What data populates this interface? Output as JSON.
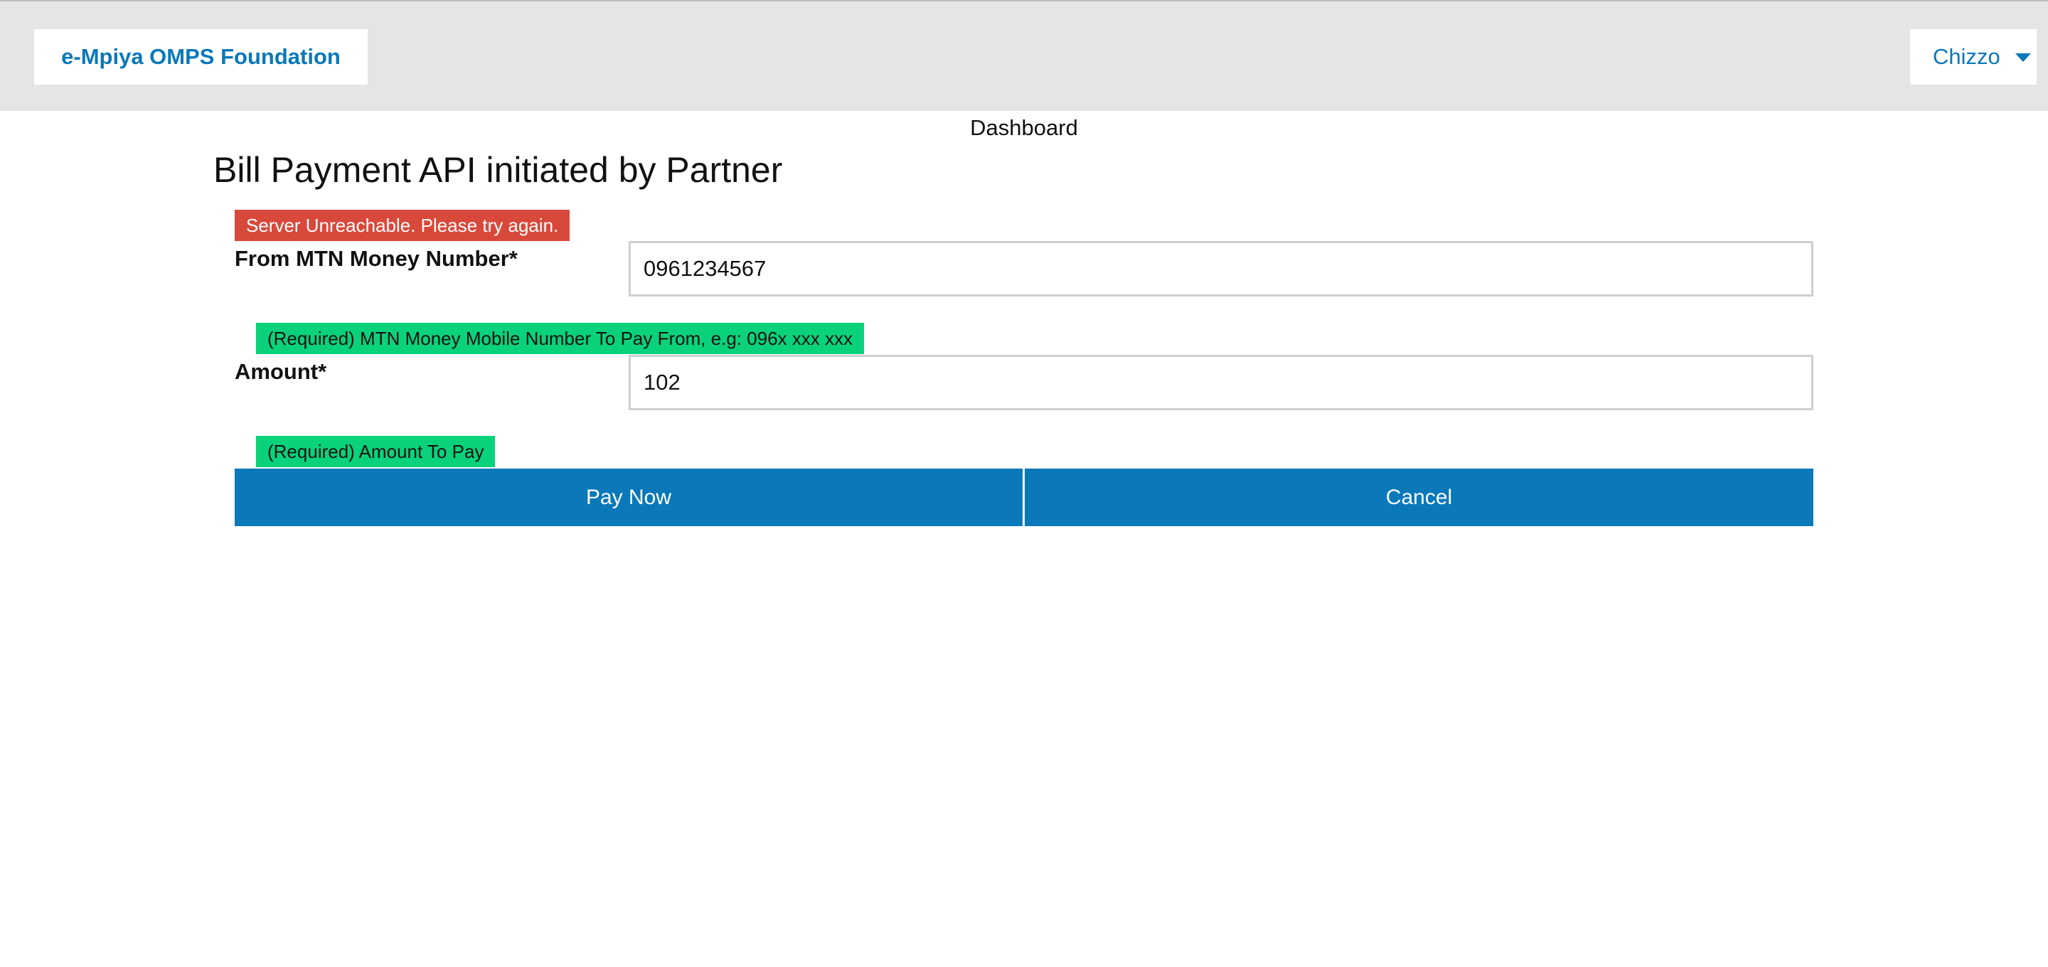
{
  "header": {
    "brand": "e-Mpiya OMPS Foundation",
    "user_name": "Chizzo"
  },
  "nav": {
    "dashboard_label": "Dashboard"
  },
  "page": {
    "title": "Bill Payment API initiated by Partner"
  },
  "alert": {
    "error_text": "Server Unreachable. Please try again."
  },
  "form": {
    "from_number": {
      "label": "From MTN Money Number*",
      "value": "0961234567",
      "hint": "(Required) MTN Money Mobile Number To Pay From, e.g: 096x xxx xxx"
    },
    "amount": {
      "label": "Amount*",
      "value": "102",
      "hint": "(Required) Amount To Pay"
    }
  },
  "actions": {
    "pay_label": "Pay Now",
    "cancel_label": "Cancel"
  },
  "colors": {
    "accent": "#0a78b9",
    "error": "#d9493b",
    "hint": "#09d27b",
    "header_bg": "#e5e5e5"
  },
  "icons": {
    "user_menu": "caret-down-icon"
  }
}
